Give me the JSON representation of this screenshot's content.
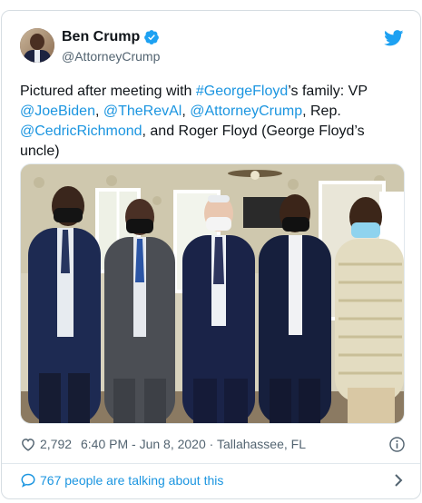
{
  "tweet": {
    "author": {
      "display_name": "Ben Crump",
      "handle": "@AttorneyCrump",
      "verified": true
    },
    "text_parts": {
      "p1": "Pictured after meeting with ",
      "hashtag": "#GeorgeFloyd",
      "p2": "’s family: VP ",
      "mention1": "@JoeBiden",
      "sep1": ", ",
      "mention2": "@TheRevAl",
      "sep2": ", ",
      "mention3": "@AttorneyCrump",
      "p3": ", Rep. ",
      "mention4": "@CedricRichmond",
      "p4": ", and Roger Floyd (George Floyd’s uncle)"
    },
    "likes": "2,792",
    "timestamp": "6:40 PM - Jun 8, 2020 · Tallahassee, FL",
    "talking": "767 people are talking about this"
  },
  "icons": {
    "verified": "verified-badge-icon",
    "bird": "twitter-bird-icon",
    "heart": "heart-icon",
    "info": "info-icon",
    "bubble": "speech-bubble-icon",
    "chevron": "chevron-right-icon"
  },
  "colors": {
    "link": "#1b95e0",
    "text": "#0f1419",
    "muted": "#536471",
    "border": "#d6dde2",
    "twitter_blue": "#1da1f2"
  }
}
